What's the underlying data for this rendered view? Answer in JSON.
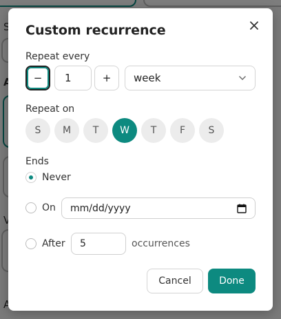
{
  "background": {
    "letters": [
      "S",
      "A",
      "V",
      "A"
    ]
  },
  "modal": {
    "title": "Custom recurrence",
    "repeat_every": {
      "label": "Repeat every",
      "decrement": "−",
      "value": "1",
      "increment": "+",
      "unit": "week"
    },
    "repeat_on": {
      "label": "Repeat on",
      "days": [
        "S",
        "M",
        "T",
        "W",
        "T",
        "F",
        "S"
      ],
      "selected_index": 3
    },
    "ends": {
      "label": "Ends",
      "never": "Never",
      "on": "On",
      "on_placeholder": "mm/dd/yyyy",
      "after": "After",
      "after_value": "5",
      "occurrences": "occurrences",
      "selected": "never"
    },
    "buttons": {
      "cancel": "Cancel",
      "done": "Done"
    }
  },
  "colors": {
    "accent": "#0d8a80"
  }
}
